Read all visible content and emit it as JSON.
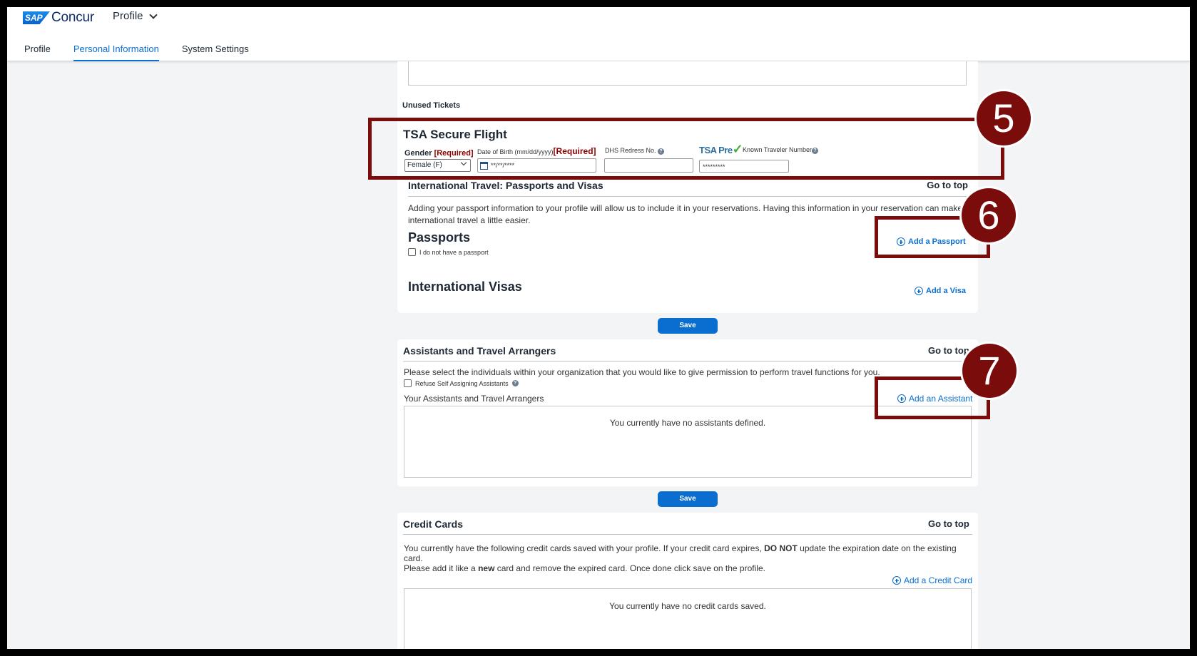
{
  "header": {
    "brand_sap": "SAP",
    "brand_name": "Concur",
    "menu_label": "Profile",
    "tabs": [
      {
        "label": "Profile"
      },
      {
        "label": "Personal Information"
      },
      {
        "label": "System Settings"
      }
    ]
  },
  "unused_tickets": {
    "label": "Unused Tickets"
  },
  "tsa": {
    "title": "TSA Secure Flight",
    "gender_label": "Gender",
    "required_text": "[Required]",
    "gender_value": "Female (F)",
    "dob_label": "Date of Birth (mm/dd/yyyy)",
    "dob_required": "[Required]",
    "dob_value": "**/**/****",
    "dhs_label": "DHS Redress No.",
    "tsa_pre_logo": "TSA Pre",
    "ktn_label": "Known Traveler Number",
    "ktn_value": "*********"
  },
  "international": {
    "title": "International Travel: Passports and Visas",
    "go_to_top": "Go to top",
    "description": "Adding your passport information to your profile will allow us to include it in your reservations. Having this information in your reservation can make international travel a little easier.",
    "passports_heading": "Passports",
    "no_passport_label": "I do not have a passport",
    "add_passport": "Add a Passport",
    "visas_heading": "International Visas",
    "add_visa": "Add a Visa",
    "save": "Save"
  },
  "assistants": {
    "title": "Assistants and Travel Arrangers",
    "go_to_top": "Go to top",
    "description": "Please select the individuals within your organization that you would like to give permission to perform travel functions for you.",
    "refuse_label": "Refuse Self Assigning Assistants",
    "list_label": "Your Assistants and Travel Arrangers",
    "add_assistant": "Add an Assistant",
    "empty_text": "You currently have no assistants defined.",
    "save": "Save"
  },
  "credit_cards": {
    "title": "Credit Cards",
    "go_to_top": "Go to top",
    "desc_part1": "You currently have the following credit cards saved with your profile. If your credit card expires, ",
    "desc_bold1": "DO NOT",
    "desc_part2": " update the expiration date on the existing card.",
    "desc_part3": "Please add it like a ",
    "desc_bold2": "new",
    "desc_part4": " card and remove the expired card. Once done click save on the profile.",
    "add_card": "Add a Credit Card",
    "empty_text": "You currently have no credit cards saved."
  },
  "callouts": [
    "5",
    "6",
    "7"
  ],
  "colors": {
    "accent": "#0a6ed1",
    "callout": "#7a0c0c",
    "required": "#8b0000"
  }
}
